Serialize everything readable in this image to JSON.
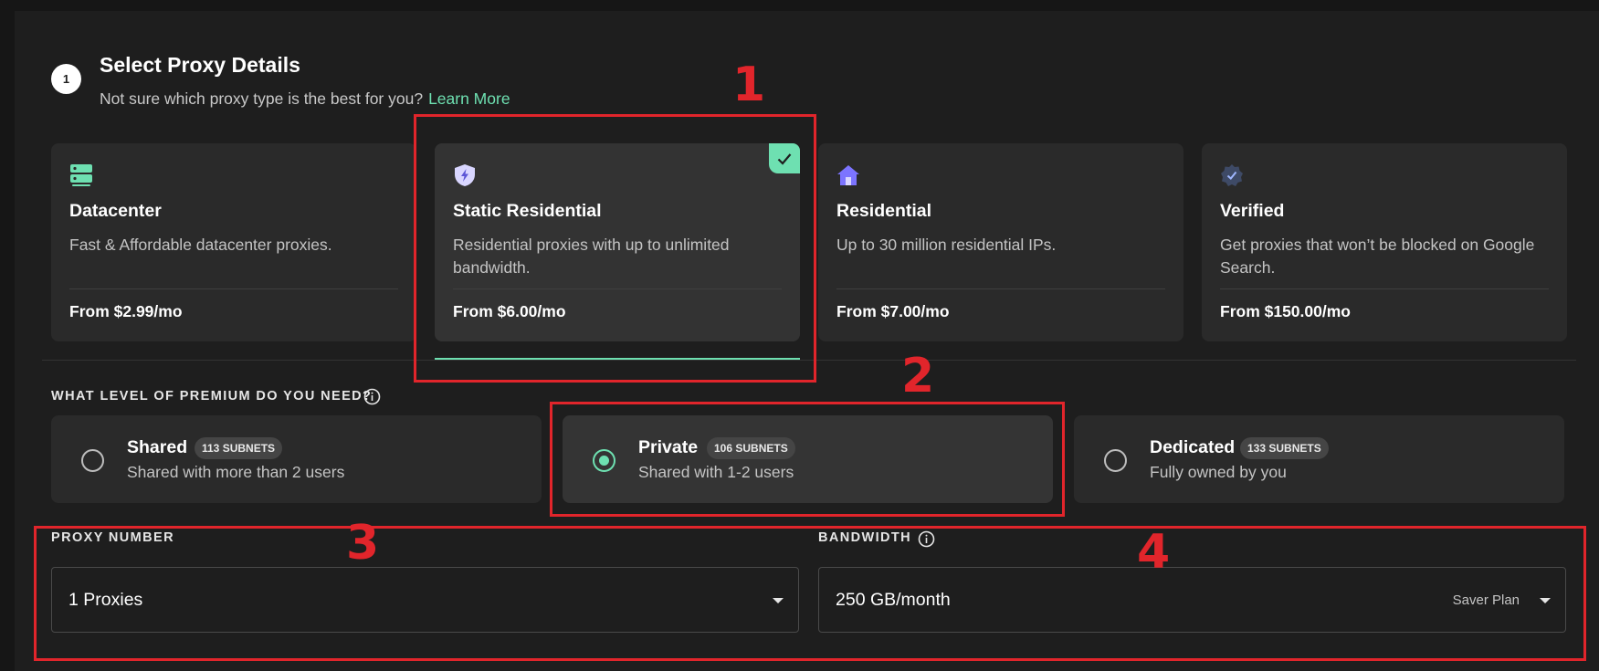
{
  "step": {
    "number": "1",
    "title": "Select Proxy Details",
    "subtitle": "Not sure which proxy type is the best for you?",
    "learn_more": "Learn More"
  },
  "proxy_types": [
    {
      "name": "Datacenter",
      "desc": "Fast & Affordable datacenter proxies.",
      "price": "From $2.99/mo",
      "icon": "server-icon",
      "selected": false
    },
    {
      "name": "Static Residential",
      "desc": "Residential proxies with up to unlimited bandwidth.",
      "price": "From $6.00/mo",
      "icon": "shield-bolt-icon",
      "selected": true
    },
    {
      "name": "Residential",
      "desc": "Up to 30 million residential IPs.",
      "price": "From $7.00/mo",
      "icon": "house-icon",
      "selected": false
    },
    {
      "name": "Verified",
      "desc": "Get proxies that won’t be blocked on Google Search.",
      "price": "From $150.00/mo",
      "icon": "verified-badge-icon",
      "selected": false
    }
  ],
  "premium": {
    "label": "WHAT LEVEL OF PREMIUM DO YOU NEED?",
    "tiers": [
      {
        "name": "Shared",
        "badge": "113 SUBNETS",
        "desc": "Shared with more than 2 users",
        "selected": false
      },
      {
        "name": "Private",
        "badge": "106 SUBNETS",
        "desc": "Shared with 1-2 users",
        "selected": true
      },
      {
        "name": "Dedicated",
        "badge": "133 SUBNETS",
        "desc": "Fully owned by you",
        "selected": false
      }
    ]
  },
  "proxy_number": {
    "label": "PROXY NUMBER",
    "value": "1 Proxies"
  },
  "bandwidth": {
    "label": "BANDWIDTH",
    "value": "250 GB/month",
    "plan": "Saver Plan"
  },
  "annotations": [
    "1",
    "2",
    "3",
    "4"
  ],
  "colors": {
    "accent": "#6ee0b1",
    "annotation": "#e1252b",
    "card": "#2a2a2a"
  }
}
